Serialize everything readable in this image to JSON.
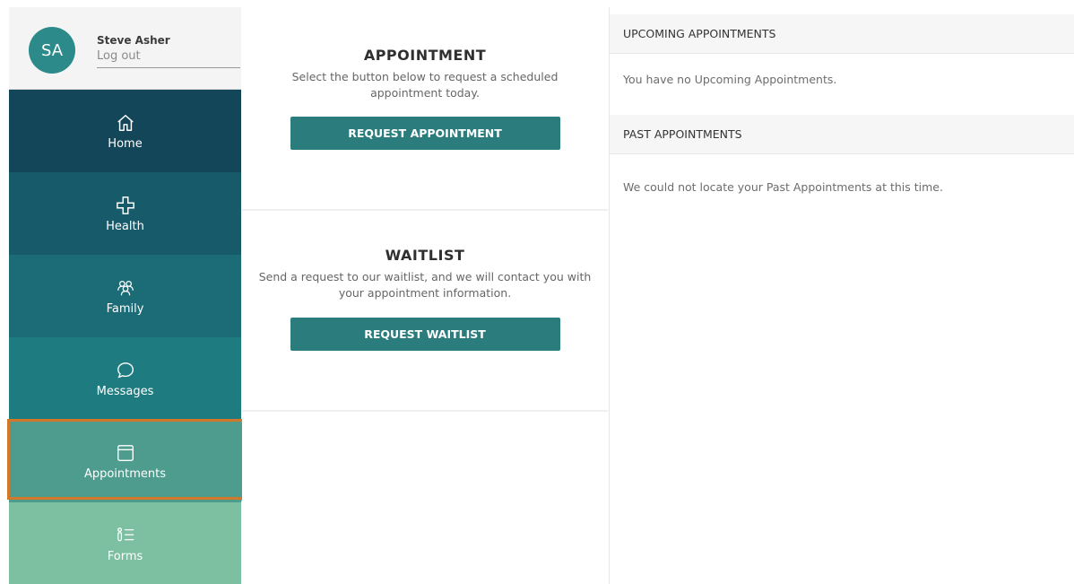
{
  "user": {
    "initials": "SA",
    "name": "Steve Asher",
    "logout_label": "Log out"
  },
  "nav": {
    "home": "Home",
    "health": "Health",
    "family": "Family",
    "messages": "Messages",
    "appointments": "Appointments",
    "forms": "Forms",
    "active": "Appointments"
  },
  "appointment_section": {
    "title": "APPOINTMENT",
    "description": "Select the button below to request a scheduled appointment today.",
    "button_label": "REQUEST APPOINTMENT"
  },
  "waitlist_section": {
    "title": "WAITLIST",
    "description": "Send a request to our waitlist, and we will contact you with your appointment information.",
    "button_label": "REQUEST WAITLIST"
  },
  "upcoming": {
    "header": "UPCOMING APPOINTMENTS",
    "message": "You have no Upcoming Appointments."
  },
  "past": {
    "header": "PAST APPOINTMENTS",
    "message": "We could not locate your Past Appointments at this time."
  },
  "colors": {
    "accent": "#2b7d7d",
    "avatar": "#2c8a8a",
    "highlight": "#d2782a"
  },
  "icons": {
    "home": "home-icon",
    "health": "health-cross-icon",
    "family": "family-icon",
    "messages": "chat-bubble-icon",
    "appointments": "calendar-icon",
    "forms": "forms-icon"
  }
}
